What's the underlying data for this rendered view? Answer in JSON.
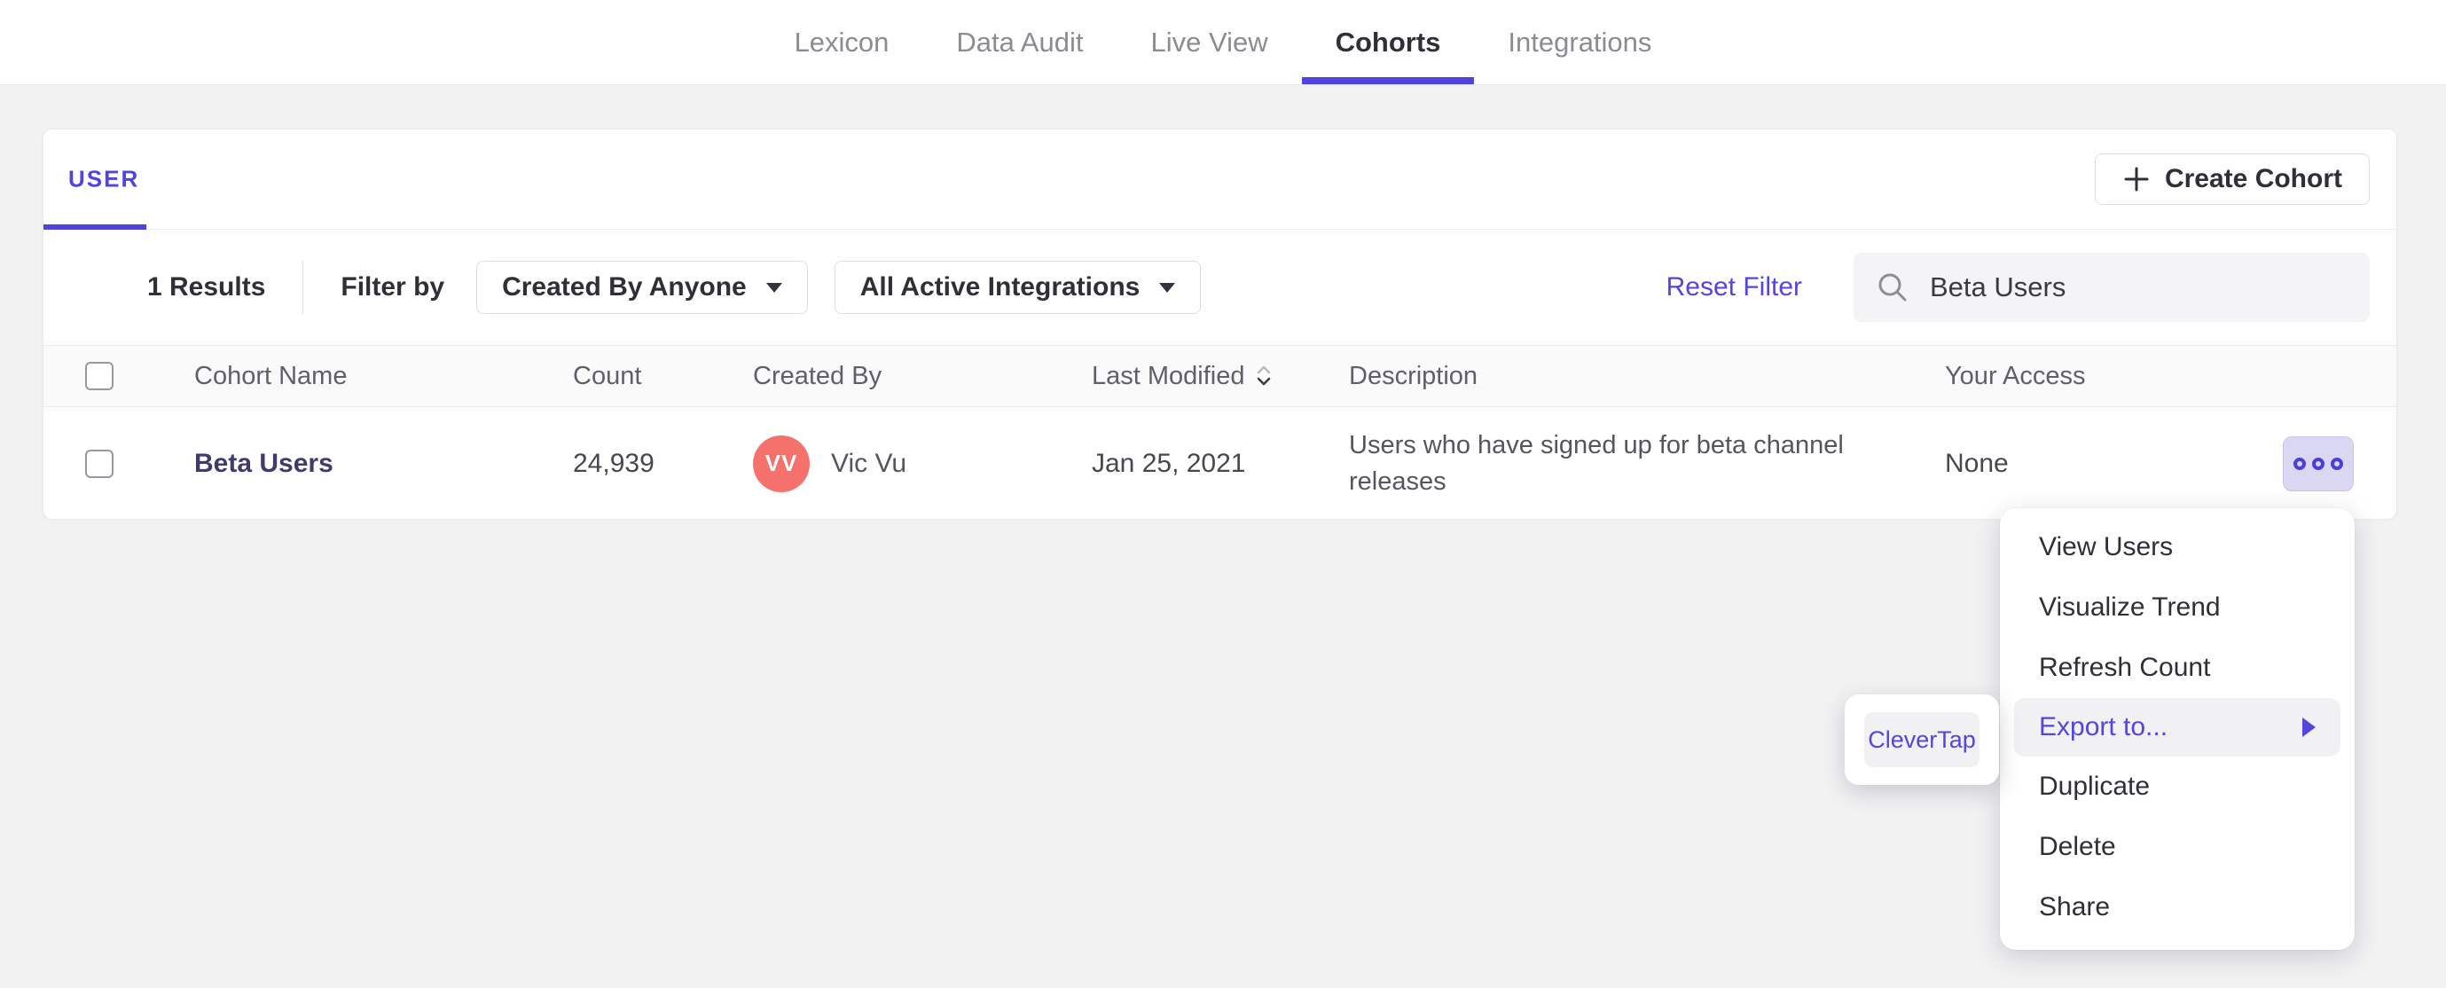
{
  "nav": {
    "tabs": [
      {
        "label": "Lexicon",
        "active": false
      },
      {
        "label": "Data Audit",
        "active": false
      },
      {
        "label": "Live View",
        "active": false
      },
      {
        "label": "Cohorts",
        "active": true
      },
      {
        "label": "Integrations",
        "active": false
      }
    ]
  },
  "cohorts_card": {
    "user_tab_label": "USER",
    "create_button_label": "Create Cohort",
    "filters": {
      "results_count": "1 Results",
      "filter_by_label": "Filter by",
      "created_by_dropdown": "Created By Anyone",
      "integrations_dropdown": "All Active Integrations",
      "reset_filter_label": "Reset Filter",
      "search_value": "Beta Users"
    },
    "table": {
      "headers": [
        "Cohort Name",
        "Count",
        "Created By",
        "Last Modified",
        "Description",
        "Your Access"
      ],
      "rows": [
        {
          "name": "Beta Users",
          "count": "24,939",
          "created_by_initials": "VV",
          "created_by_name": "Vic Vu",
          "last_modified": "Jan 25, 2021",
          "description": "Users who have signed up for beta channel releases",
          "access": "None"
        }
      ]
    }
  },
  "context_menu": {
    "items": [
      {
        "label": "View Users"
      },
      {
        "label": "Visualize Trend"
      },
      {
        "label": "Refresh Count"
      },
      {
        "label": "Export to...",
        "highlighted": true,
        "has_submenu": true
      },
      {
        "label": "Duplicate"
      },
      {
        "label": "Delete"
      },
      {
        "label": "Share"
      }
    ],
    "submenu_items": [
      {
        "label": "CleverTap",
        "highlighted": true
      }
    ]
  },
  "colors": {
    "accent_purple": "#4f44e0",
    "link_purple": "#5246df",
    "cohort_link": "#3f3c6d",
    "avatar_bg": "#f5716c",
    "page_bg": "#f2f2f3",
    "options_btn_bg": "#dad7f3",
    "menu_highlight_bg": "#f1f1f3"
  }
}
